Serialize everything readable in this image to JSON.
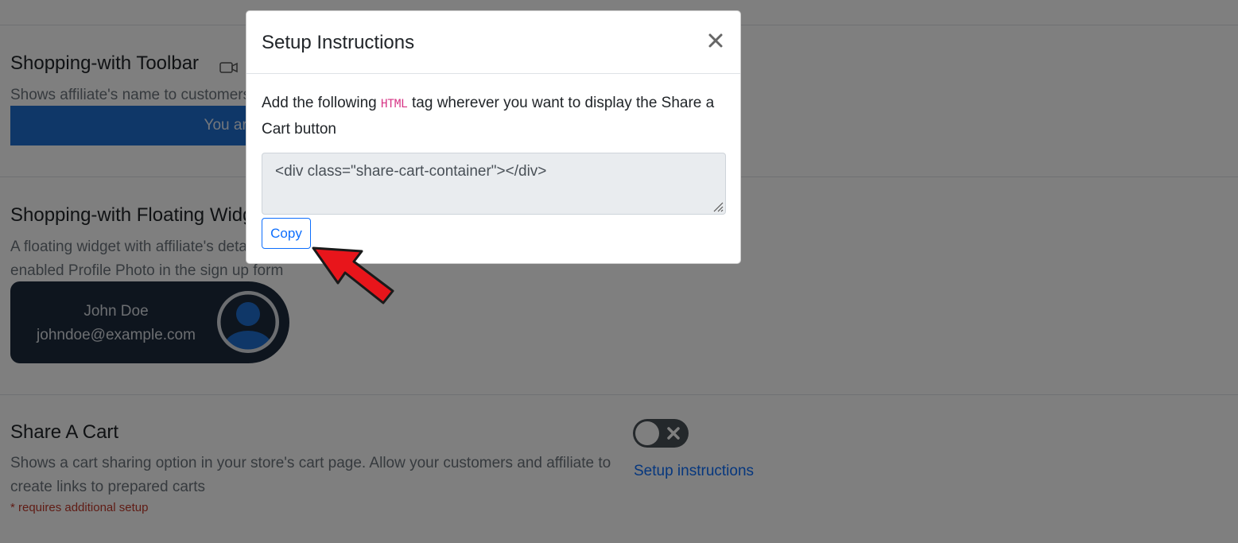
{
  "sections": {
    "toolbar": {
      "title": "Shopping-with Toolbar",
      "description": "Shows affiliate's name to customers",
      "preview_text": "You are shopping with John Doe"
    },
    "floating_widget": {
      "title": "Shopping-with Floating Widget",
      "description": "A floating widget with affiliate's details. Affiliate's photo will only be shown if you have enabled Profile Photo in the sign up form",
      "widget_name": "John Doe",
      "widget_email": "johndoe@example.com"
    },
    "share_cart": {
      "title": "Share A Cart",
      "description": "Shows a cart sharing option in your store's cart page. Allow your customers and affiliate to create links to prepared carts",
      "requirement_note": "* requires additional setup",
      "toggle_state": "off",
      "setup_link": "Setup instructions"
    }
  },
  "modal": {
    "title": "Setup Instructions",
    "text_before": "Add the following ",
    "code_tag": "HTML",
    "text_after": " tag wherever you want to display the Share a Cart button",
    "code_value": "<div class=\"share-cart-container\"></div>",
    "copy_label": "Copy"
  },
  "colors": {
    "accent": "#0d6efd",
    "toolbar_bg": "#1f6fd1",
    "widget_bg": "#1c2a3d",
    "arrow": "#e8151b"
  },
  "icons": {
    "toolbar": "video-camera-icon",
    "avatar": "user-avatar-icon",
    "toggle": "x-icon",
    "close": "close-icon",
    "pointer": "red-arrow-annotation"
  }
}
